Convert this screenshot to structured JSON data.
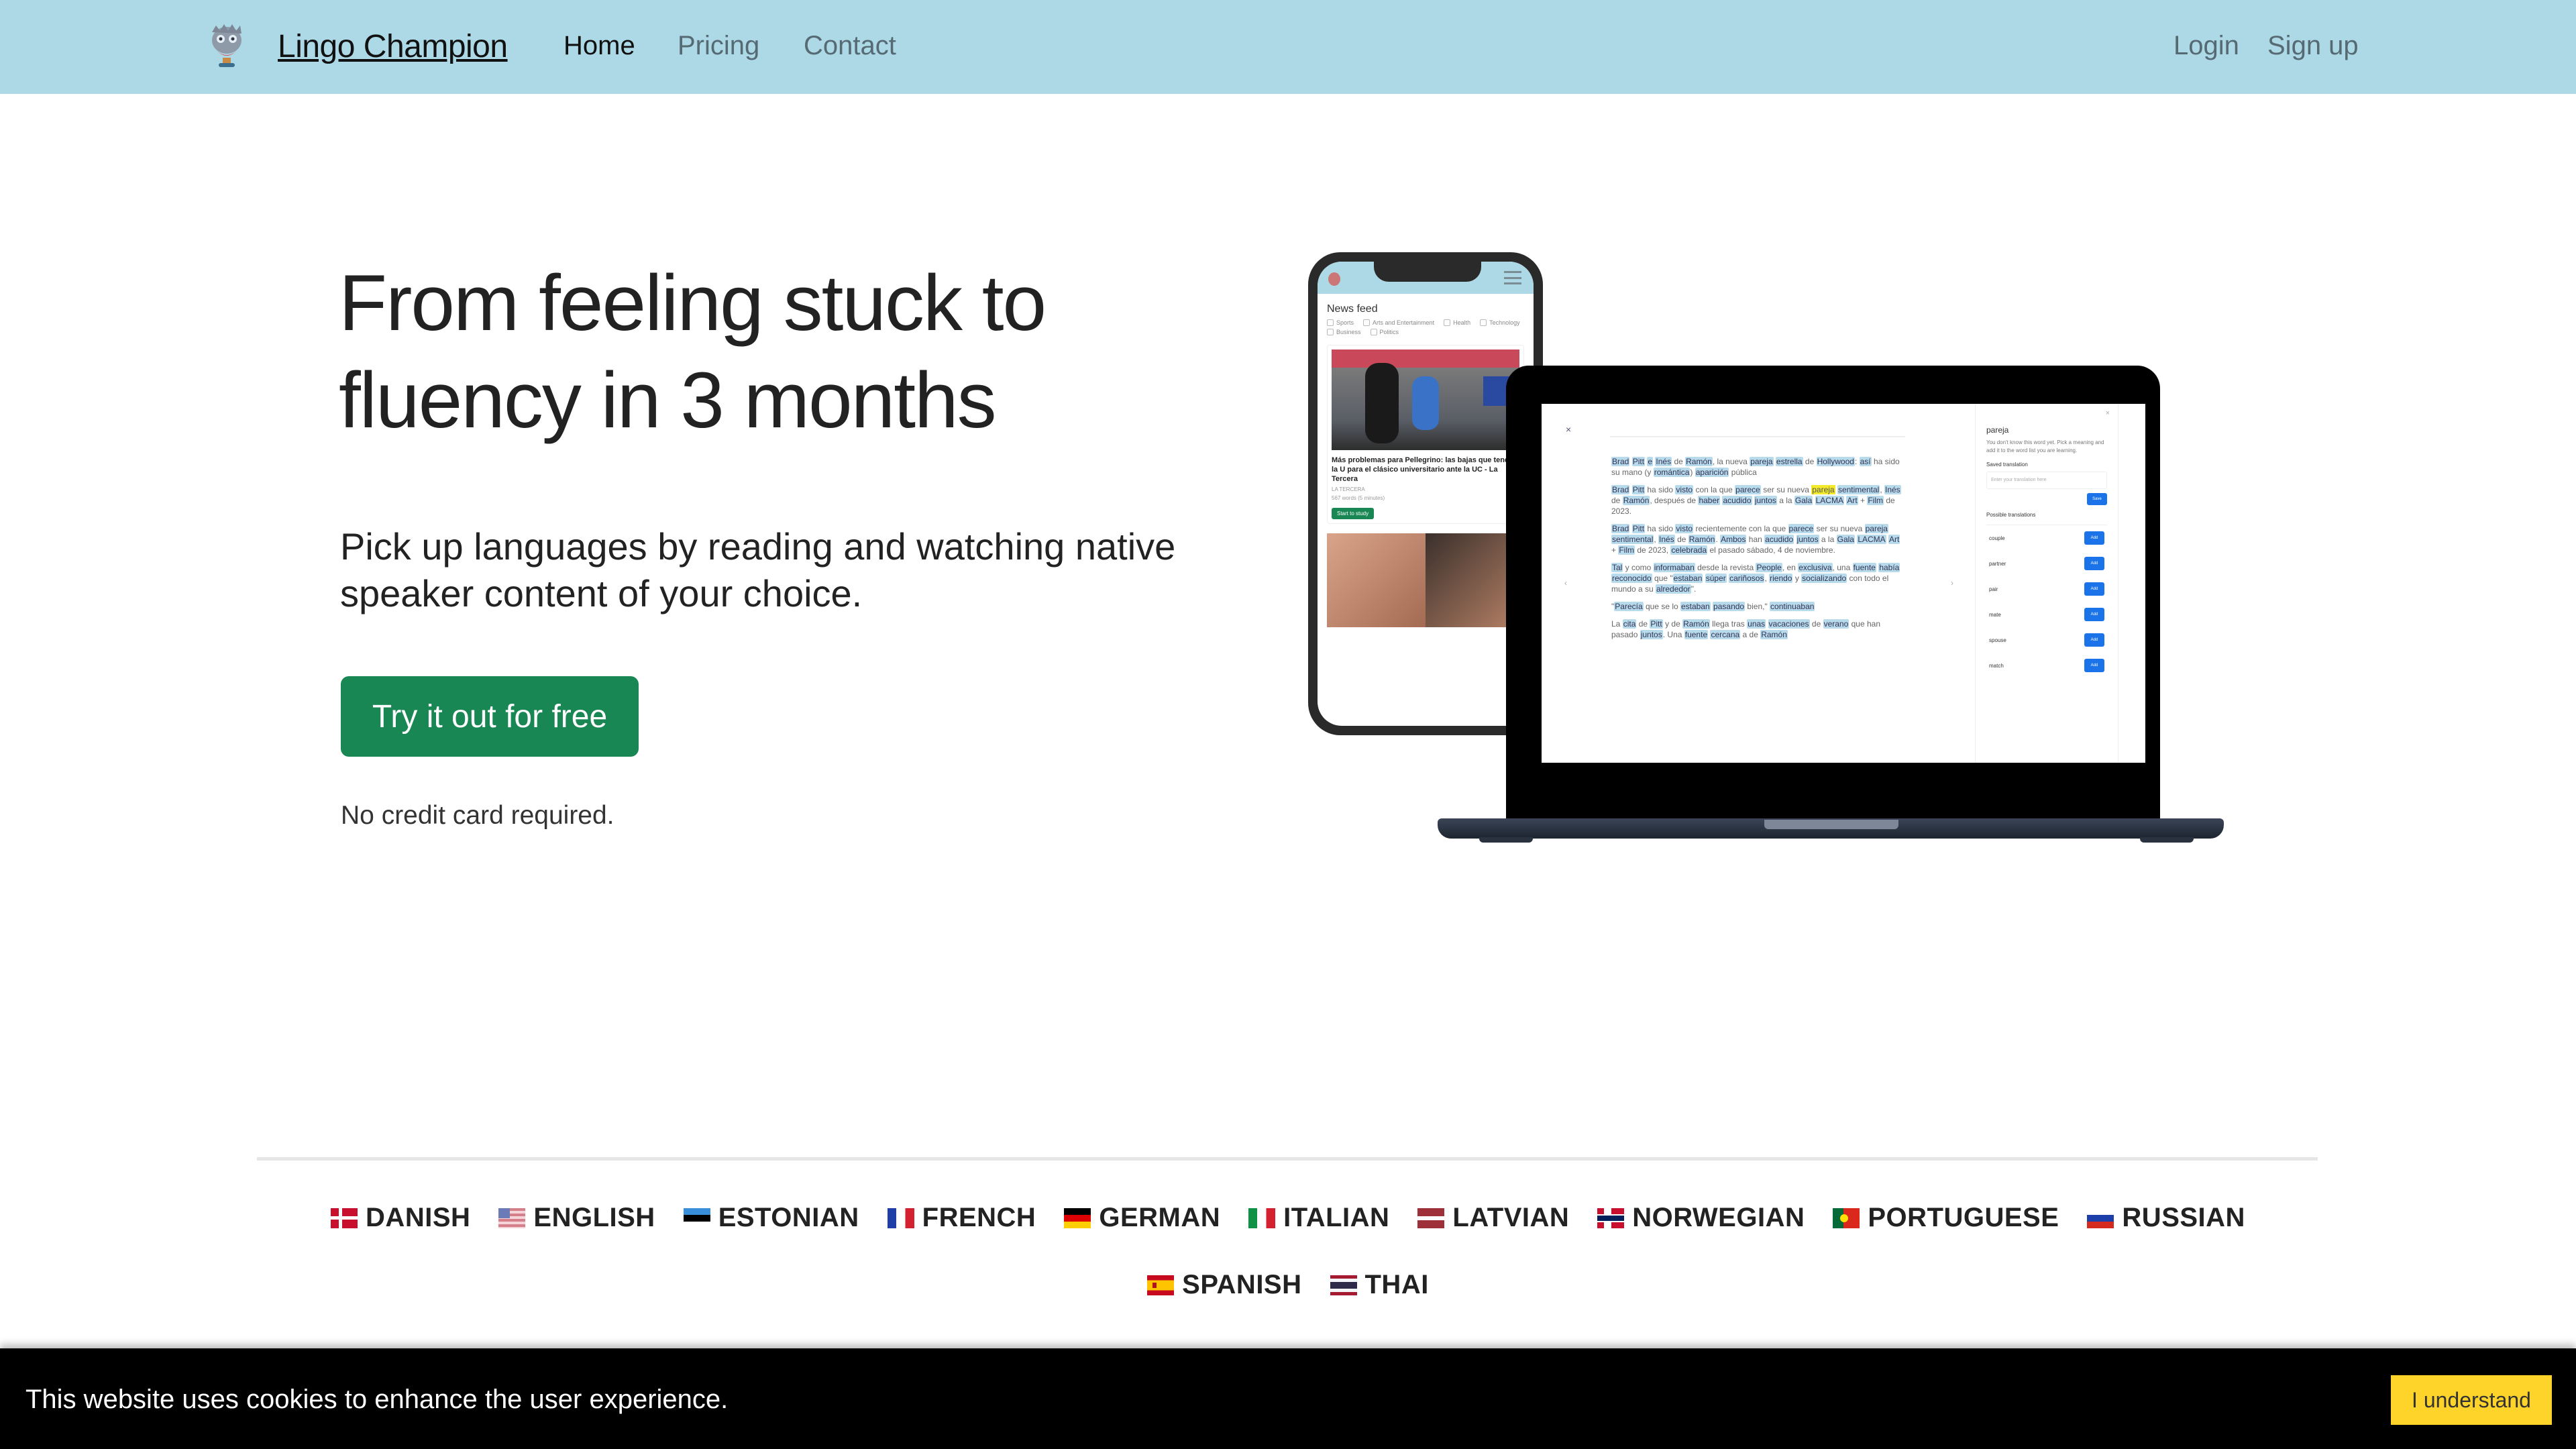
{
  "navbar": {
    "brand_name": "Lingo Champion",
    "logo_icon": "owl-mascot-icon",
    "links": [
      {
        "label": "Home",
        "active": true
      },
      {
        "label": "Pricing",
        "active": false
      },
      {
        "label": "Contact",
        "active": false
      }
    ],
    "login_label": "Login",
    "signup_label": "Sign up",
    "background_color": "#add8e6"
  },
  "hero": {
    "title_line1": "From feeling stuck to",
    "title_line2": "fluency in 3 months",
    "subtitle_line1": "Pick up languages by reading and watching native",
    "subtitle_line2": "speaker content of your choice.",
    "cta_label": "Try it out for free",
    "cta_color": "#198754",
    "note": "No credit card required."
  },
  "phone_mockup": {
    "feed_title": "News feed",
    "categories": [
      "Sports",
      "Arts and Entertainment",
      "Health",
      "Technology",
      "Business",
      "Politics"
    ],
    "card": {
      "title": "Más problemas para Pellegrino: las bajas que tendrá la U para el clásico universitario ante la UC - La Tercera",
      "source": "LA TERCERA",
      "meta": "567 words (5 minutes)",
      "button_label": "Start to study"
    }
  },
  "laptop_mockup": {
    "close_symbol": "×",
    "left_arrow": "‹",
    "right_arrow": "›",
    "paragraphs": [
      [
        [
          "Brad",
          "w"
        ],
        " ",
        [
          "Pitt",
          "w"
        ],
        " ",
        [
          "e",
          "w"
        ],
        " ",
        [
          "Inés",
          "w"
        ],
        " de ",
        [
          "Ramón",
          "w"
        ],
        ", la nueva ",
        [
          "pareja",
          "w"
        ],
        " ",
        [
          "estrella",
          "w"
        ],
        " de ",
        [
          "Hollywood",
          "w"
        ],
        ": ",
        [
          "así",
          "w"
        ],
        " ha sido su mano (y ",
        [
          "romántica",
          "w"
        ],
        ") ",
        [
          "aparición",
          "w"
        ],
        " pública"
      ],
      [
        [
          "Brad",
          "w"
        ],
        " ",
        [
          "Pitt",
          "w"
        ],
        " ha sido ",
        [
          "visto",
          "w"
        ],
        " con la que ",
        [
          "parece",
          "w"
        ],
        " ser su nueva ",
        [
          "pareja",
          "y"
        ],
        " ",
        [
          "sentimental",
          "w"
        ],
        ", ",
        [
          "Inés",
          "w"
        ],
        " de ",
        [
          "Ramón",
          "w"
        ],
        ", después de ",
        [
          "haber",
          "w"
        ],
        " ",
        [
          "acudido",
          "w"
        ],
        " ",
        [
          "juntos",
          "w"
        ],
        " a la ",
        [
          "Gala",
          "w"
        ],
        " ",
        [
          "LACMA",
          "w"
        ],
        " ",
        [
          "Art",
          "w"
        ],
        " + ",
        [
          "Film",
          "w"
        ],
        " de 2023."
      ],
      [
        [
          "Brad",
          "w"
        ],
        " ",
        [
          "Pitt",
          "w"
        ],
        " ha sido ",
        [
          "visto",
          "w"
        ],
        " recientemente con la que ",
        [
          "parece",
          "w"
        ],
        " ser su nueva ",
        [
          "pareja",
          "w"
        ],
        " ",
        [
          "sentimental",
          "w"
        ],
        ", ",
        [
          "Inés",
          "w"
        ],
        " de ",
        [
          "Ramón",
          "w"
        ],
        ". ",
        [
          "Ambos",
          "w"
        ],
        " han ",
        [
          "acudido",
          "w"
        ],
        " ",
        [
          "juntos",
          "w"
        ],
        " a la ",
        [
          "Gala",
          "w"
        ],
        " ",
        [
          "LACMA",
          "w"
        ],
        " ",
        [
          "Art",
          "w"
        ],
        " + ",
        [
          "Film",
          "w"
        ],
        " de 2023, ",
        [
          "celebrada",
          "w"
        ],
        " el pasado sábado, 4 de noviembre."
      ],
      [
        [
          "Tal",
          "w"
        ],
        " y como ",
        [
          "informaban",
          "w"
        ],
        " desde la revista ",
        [
          "People",
          "w"
        ],
        ", en ",
        [
          "exclusiva",
          "w"
        ],
        ", una ",
        [
          "fuente",
          "w"
        ],
        " ",
        [
          "había",
          "w"
        ],
        " ",
        [
          "reconocido",
          "w"
        ],
        " que \"",
        [
          "estaban",
          "w"
        ],
        " ",
        [
          "súper",
          "w"
        ],
        " ",
        [
          "cariñosos",
          "w"
        ],
        ", ",
        [
          "riendo",
          "w"
        ],
        " y ",
        [
          "socializando",
          "w"
        ],
        " con todo el mundo a su ",
        [
          "alrededor",
          "w"
        ],
        "\"."
      ],
      [
        "\"",
        [
          "Parecía",
          "w"
        ],
        " que se lo ",
        [
          "estaban",
          "w"
        ],
        " ",
        [
          "pasando",
          "w"
        ],
        " bien,\" ",
        [
          "continuaban",
          "w"
        ]
      ],
      [
        "La ",
        [
          "cita",
          "w"
        ],
        " de ",
        [
          "Pitt",
          "w"
        ],
        " y de ",
        [
          "Ramón",
          "w"
        ],
        " llega tras ",
        [
          "unas",
          "w"
        ],
        " ",
        [
          "vacaciones",
          "w"
        ],
        " de ",
        [
          "verano",
          "w"
        ],
        " que han pasado ",
        [
          "juntos",
          "w"
        ],
        ". Una ",
        [
          "fuente",
          "w"
        ],
        " ",
        [
          "cercana",
          "w"
        ],
        " a de ",
        [
          "Ramón",
          "w"
        ]
      ]
    ],
    "dictionary": {
      "close_symbol": "×",
      "word": "pareja",
      "hint": "You don't know this word yet. Pick a meaning and add it to the word list you are learning.",
      "own_translation_label": "Saved translation",
      "input_placeholder": "Enter your translation here",
      "save_label": "Save",
      "possible_label": "Possible translations",
      "translations": [
        "couple",
        "partner",
        "pair",
        "mate",
        "spouse",
        "match"
      ],
      "add_label": "Add"
    }
  },
  "languages": {
    "row1": [
      {
        "label": "DANISH",
        "flag": "dk"
      },
      {
        "label": "ENGLISH",
        "flag": "us"
      },
      {
        "label": "ESTONIAN",
        "flag": "ee"
      },
      {
        "label": "FRENCH",
        "flag": "fr"
      },
      {
        "label": "GERMAN",
        "flag": "de"
      },
      {
        "label": "ITALIAN",
        "flag": "it"
      },
      {
        "label": "LATVIAN",
        "flag": "lv"
      },
      {
        "label": "NORWEGIAN",
        "flag": "no"
      },
      {
        "label": "PORTUGUESE",
        "flag": "pt"
      },
      {
        "label": "RUSSIAN",
        "flag": "ru"
      }
    ],
    "row2": [
      {
        "label": "SPANISH",
        "flag": "es"
      },
      {
        "label": "THAI",
        "flag": "th"
      }
    ]
  },
  "cookie_banner": {
    "message": "This website uses cookies to enhance the user experience.",
    "accept_label": "I understand",
    "accept_color": "#ffd42a"
  }
}
